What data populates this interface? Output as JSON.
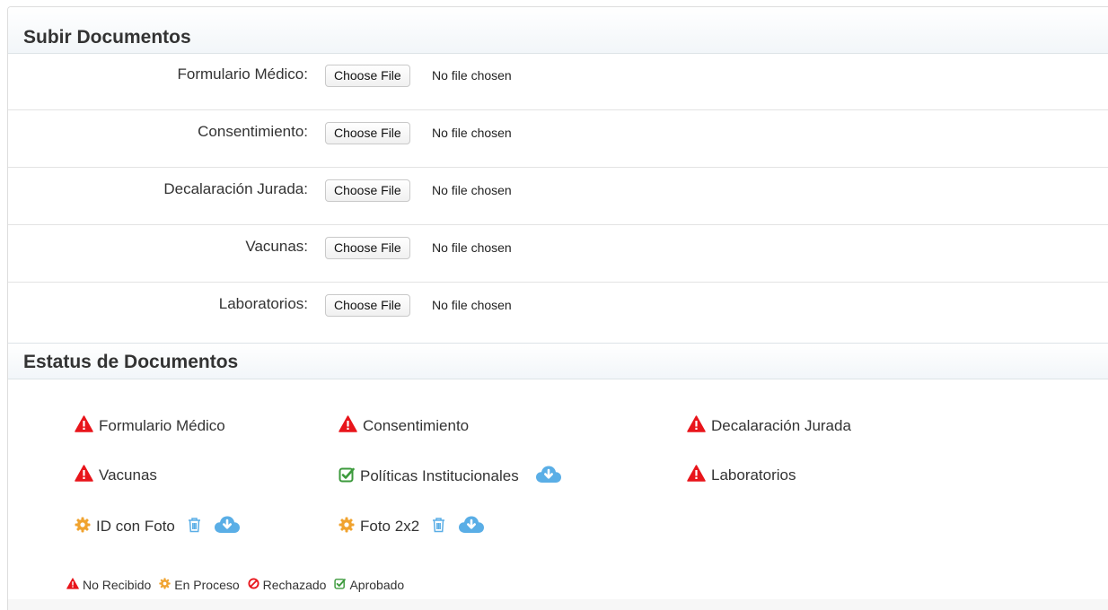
{
  "upload": {
    "title": "Subir Documentos",
    "rows": [
      {
        "label": "Formulario Médico:",
        "button": "Choose File",
        "status": "No file chosen"
      },
      {
        "label": "Consentimiento:",
        "button": "Choose File",
        "status": "No file chosen"
      },
      {
        "label": "Decalaración Jurada:",
        "button": "Choose File",
        "status": "No file chosen"
      },
      {
        "label": "Vacunas:",
        "button": "Choose File",
        "status": "No file chosen"
      },
      {
        "label": "Laboratorios:",
        "button": "Choose File",
        "status": "No file chosen"
      }
    ]
  },
  "status": {
    "title": "Estatus de Documentos",
    "items": [
      {
        "label": "Formulario Médico",
        "state": "no-recibido",
        "icon": "warning-icon"
      },
      {
        "label": "Consentimiento",
        "state": "no-recibido",
        "icon": "warning-icon"
      },
      {
        "label": "Decalaración Jurada",
        "state": "no-recibido",
        "icon": "warning-icon"
      },
      {
        "label": "Vacunas",
        "state": "no-recibido",
        "icon": "warning-icon"
      },
      {
        "label": "Políticas Institucionales",
        "state": "aprobado",
        "icon": "check-icon"
      },
      {
        "label": "Laboratorios",
        "state": "no-recibido",
        "icon": "warning-icon"
      },
      {
        "label": "ID con Foto",
        "state": "en-proceso",
        "icon": "gear-icon"
      },
      {
        "label": "Foto 2x2",
        "state": "en-proceso",
        "icon": "gear-icon"
      }
    ]
  },
  "legend": [
    {
      "label": "No Recibido",
      "icon": "warning-icon"
    },
    {
      "label": "En Proceso",
      "icon": "gear-icon"
    },
    {
      "label": "Rechazado",
      "icon": "ban-icon"
    },
    {
      "label": "Aprobado",
      "icon": "check-icon"
    }
  ],
  "colors": {
    "no_recibido": "#e8151b",
    "en_proceso": "#f0a32f",
    "rechazado": "#e8151b",
    "aprobado": "#3c9a3c",
    "action_icon": "#5aaee6"
  }
}
